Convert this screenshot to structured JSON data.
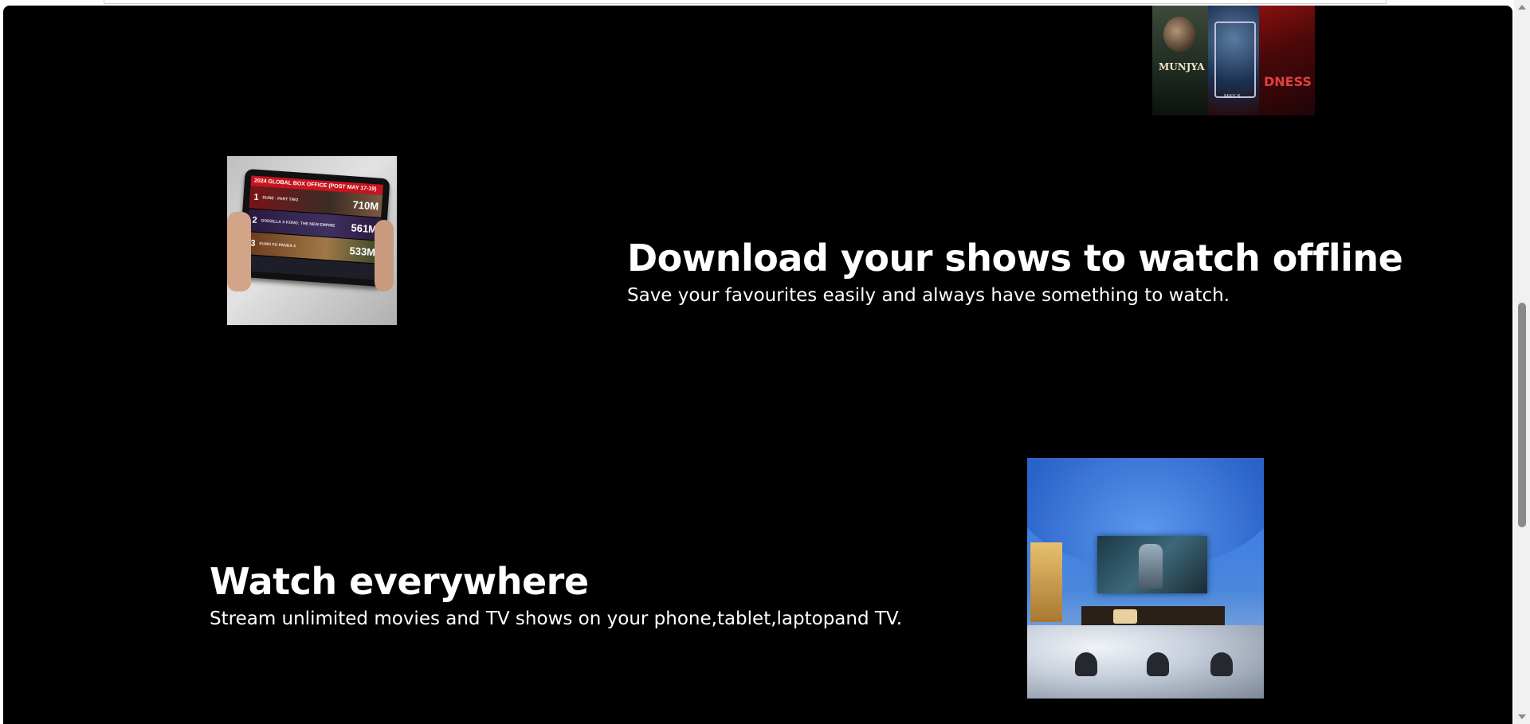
{
  "features": {
    "download": {
      "title": "Download your shows to watch offline",
      "description": "Save your favourites easily and always have something to watch."
    },
    "everywhere": {
      "title": "Watch everywhere",
      "description": "Stream unlimited movies and TV shows on your phone,tablet,laptopand TV."
    }
  },
  "poster_collage": {
    "poster_1_title": "MUNJYA",
    "poster_2_date": "MAY 6",
    "poster_3_text": "DNESS"
  },
  "box_office": {
    "header": "2024 GLOBAL BOX OFFICE (POST MAY 17-19)",
    "rows": [
      {
        "rank": "1",
        "label": "DUNE · PART TWO",
        "amount": "710M"
      },
      {
        "rank": "2",
        "label": "GODZILLA X KONG: THE NEW EMPIRE",
        "amount": "561M"
      },
      {
        "rank": "3",
        "label": "KUNG FU PANDA 4",
        "amount": "533M"
      }
    ]
  },
  "colors": {
    "page_background": "#000000",
    "text": "#ffffff",
    "scrollbar_track": "#f1f1f1",
    "scrollbar_thumb": "#8a8a8a"
  },
  "scrollbar": {
    "position_fraction": 0.5
  }
}
